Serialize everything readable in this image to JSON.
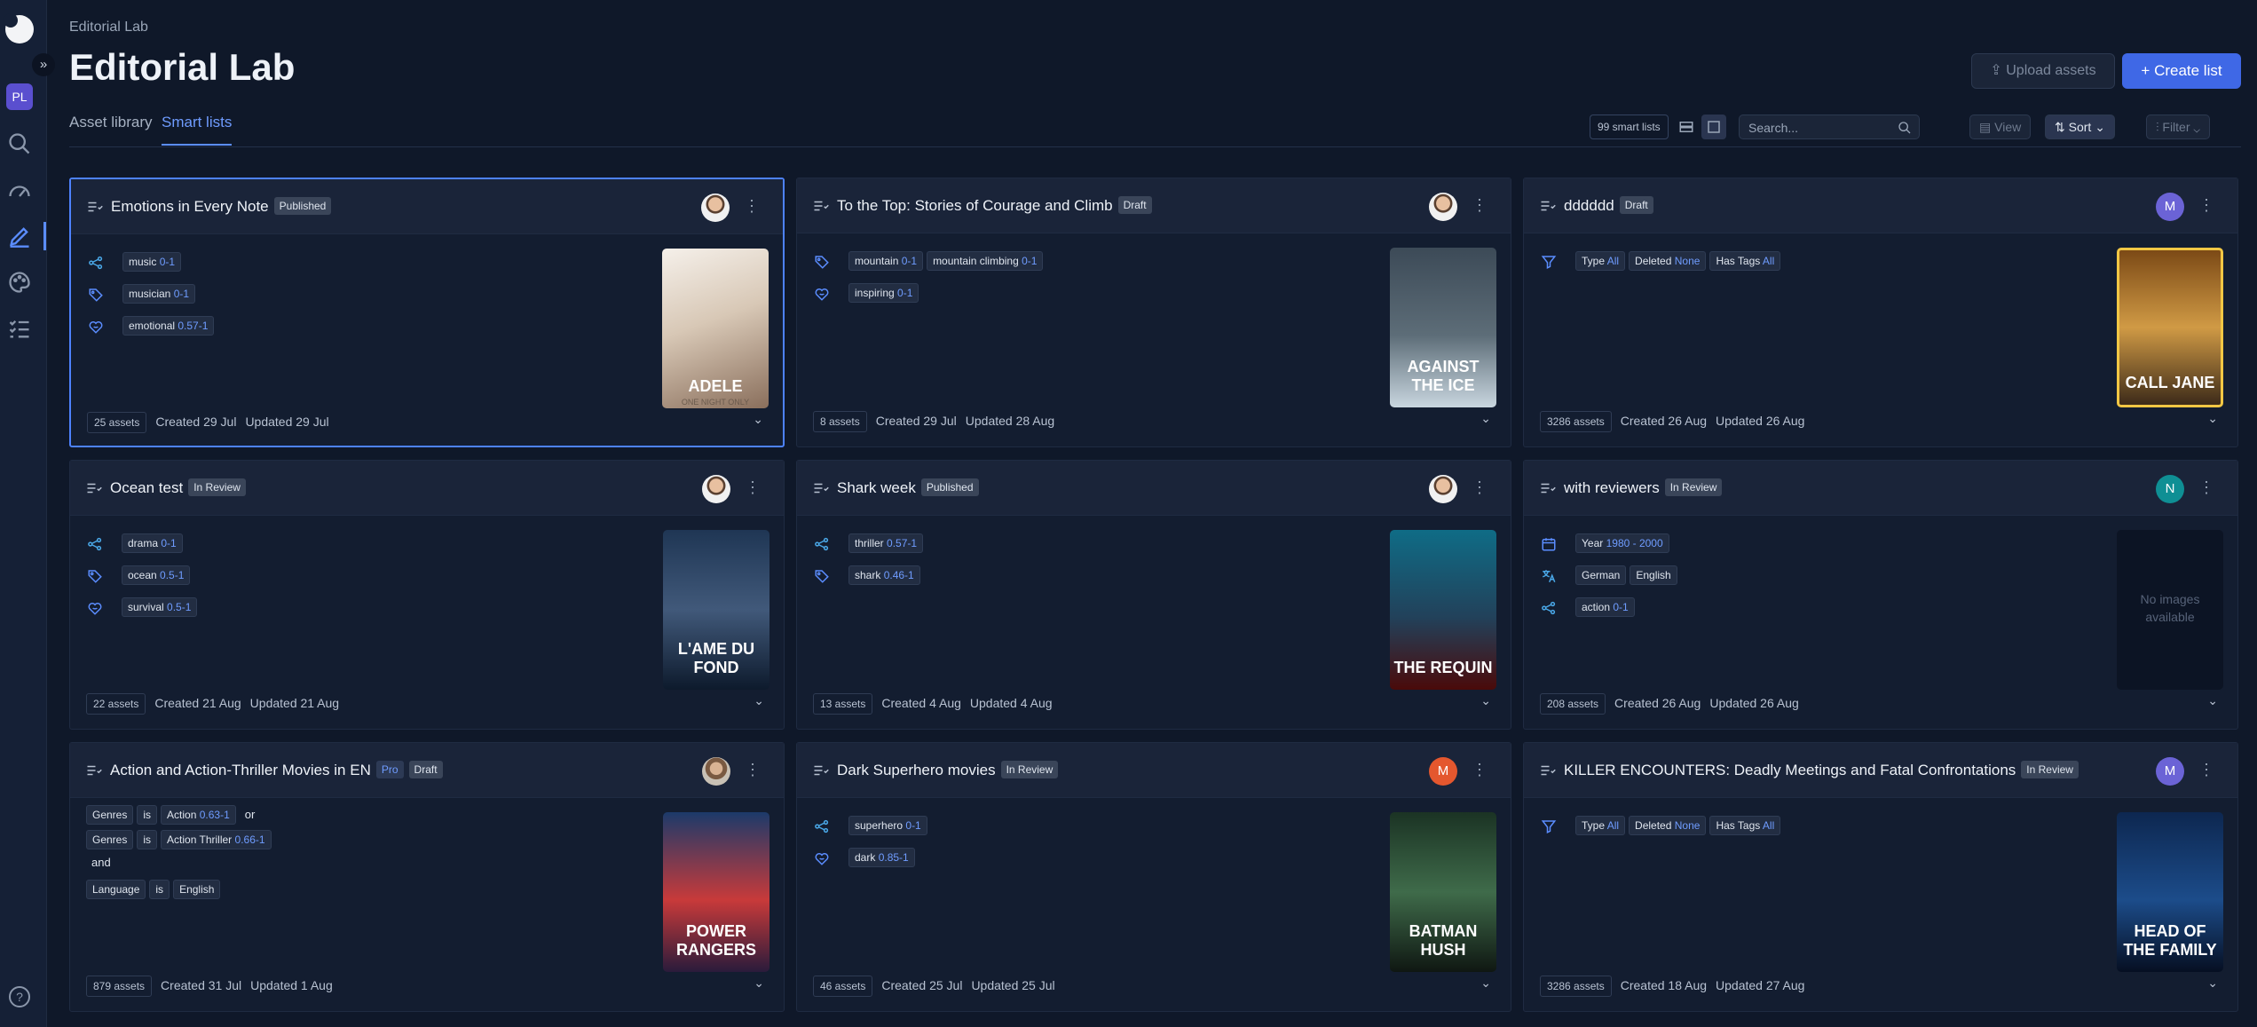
{
  "app": {
    "breadcrumb": "Editorial Lab",
    "title": "Editorial Lab",
    "user_initials": "PL"
  },
  "header": {
    "upload_label": "Upload assets",
    "create_label": "Create list"
  },
  "tabs": [
    {
      "label": "Asset library"
    },
    {
      "label": "Smart lists",
      "active": true
    }
  ],
  "toolbar": {
    "count_label": "99 smart lists",
    "search_placeholder": "Search...",
    "view_label": "View",
    "sort_label": "Sort",
    "filter_label": "Filter"
  },
  "colors": {
    "accent": "#3f68e6",
    "background": "#0f1829",
    "card": "#131d30"
  },
  "cards": [
    {
      "title": "Emotions in Every Note",
      "status": "Published",
      "avatar": {
        "type": "photo"
      },
      "selected": true,
      "rows": [
        {
          "icon": "graph-icon",
          "chips": [
            {
              "label": "music",
              "value": "0-1"
            }
          ]
        },
        {
          "icon": "tag-icon",
          "chips": [
            {
              "label": "musician",
              "value": "0-1"
            }
          ]
        },
        {
          "icon": "emotion-icon",
          "chips": [
            {
              "label": "emotional",
              "value": "0.57-1"
            }
          ]
        }
      ],
      "poster": {
        "text": "ADELE",
        "sub": "ONE NIGHT ONLY"
      },
      "assets": "25 assets",
      "created": "Created 29 Jul",
      "updated": "Updated 29 Jul"
    },
    {
      "title": "To the Top: Stories of Courage and Climb",
      "status": "Draft",
      "avatar": {
        "type": "photo"
      },
      "rows": [
        {
          "icon": "tag-icon",
          "chips": [
            {
              "label": "mountain",
              "value": "0-1"
            },
            {
              "label": "mountain climbing",
              "value": "0-1"
            }
          ]
        },
        {
          "icon": "emotion-icon",
          "chips": [
            {
              "label": "inspiring",
              "value": "0-1"
            }
          ]
        }
      ],
      "poster": {
        "text": "AGAINST THE ICE"
      },
      "assets": "8 assets",
      "created": "Created 29 Jul",
      "updated": "Updated 28 Aug"
    },
    {
      "title": "dddddd",
      "status": "Draft",
      "avatar": {
        "type": "letter",
        "letter": "M",
        "color": "#6b63d6"
      },
      "rows": [
        {
          "icon": "filter-icon",
          "chips": [
            {
              "label": "Type",
              "value": "All"
            },
            {
              "label": "Deleted",
              "value": "None"
            },
            {
              "label": "Has Tags",
              "value": "All"
            }
          ]
        }
      ],
      "poster": {
        "text": "CALL JANE"
      },
      "assets": "3286 assets",
      "created": "Created 26 Aug",
      "updated": "Updated 26 Aug"
    },
    {
      "title": "Ocean test",
      "status": "In Review",
      "avatar": {
        "type": "photo"
      },
      "rows": [
        {
          "icon": "graph-icon",
          "chips": [
            {
              "label": "drama",
              "value": "0-1"
            }
          ]
        },
        {
          "icon": "tag-icon",
          "chips": [
            {
              "label": "ocean",
              "value": "0.5-1"
            }
          ]
        },
        {
          "icon": "emotion-icon",
          "chips": [
            {
              "label": "survival",
              "value": "0.5-1"
            }
          ]
        }
      ],
      "poster": {
        "text": "L'AME DU FOND"
      },
      "assets": "22 assets",
      "created": "Created 21 Aug",
      "updated": "Updated 21 Aug"
    },
    {
      "title": "Shark week",
      "status": "Published",
      "avatar": {
        "type": "photo"
      },
      "rows": [
        {
          "icon": "graph-icon",
          "chips": [
            {
              "label": "thriller",
              "value": "0.57-1"
            }
          ]
        },
        {
          "icon": "tag-icon",
          "chips": [
            {
              "label": "shark",
              "value": "0.46-1"
            }
          ]
        }
      ],
      "poster": {
        "text": "THE REQUIN"
      },
      "assets": "13 assets",
      "created": "Created 4 Aug",
      "updated": "Updated 4 Aug"
    },
    {
      "title": "with reviewers",
      "status": "In Review",
      "avatar": {
        "type": "letter",
        "letter": "N",
        "color": "#0f8f94"
      },
      "rows": [
        {
          "icon": "calendar-icon",
          "chips": [
            {
              "label": "Year",
              "value": "1980 - 2000"
            }
          ]
        },
        {
          "icon": "language-icon",
          "chips": [
            {
              "label": "German",
              "value": ""
            },
            {
              "label": "English",
              "value": ""
            }
          ]
        },
        {
          "icon": "graph-icon",
          "chips": [
            {
              "label": "action",
              "value": "0-1"
            }
          ]
        }
      ],
      "no_image": "No images available",
      "assets": "208 assets",
      "created": "Created 26 Aug",
      "updated": "Updated 26 Aug"
    },
    {
      "title": "Action and Action-Thriller Movies in EN",
      "status": "Draft",
      "pro": "Pro",
      "avatar": {
        "type": "photo2"
      },
      "rules": [
        [
          {
            "chip": "Genres"
          },
          {
            "chip": "is"
          },
          {
            "chip": "Action",
            "value": "0.63-1"
          },
          {
            "text": "or"
          }
        ],
        [
          {
            "chip": "Genres"
          },
          {
            "chip": "is"
          },
          {
            "chip": "Action Thriller",
            "value": "0.66-1"
          }
        ],
        [
          {
            "text": "and"
          }
        ],
        [
          {
            "chip": "Language"
          },
          {
            "chip": "is"
          },
          {
            "chip": "English"
          }
        ]
      ],
      "poster": {
        "text": "POWER RANGERS"
      },
      "assets": "879 assets",
      "created": "Created 31 Jul",
      "updated": "Updated 1 Aug"
    },
    {
      "title": "Dark Superhero movies",
      "status": "In Review",
      "avatar": {
        "type": "letter",
        "letter": "M",
        "color": "#e4572e"
      },
      "rows": [
        {
          "icon": "graph-icon",
          "chips": [
            {
              "label": "superhero",
              "value": "0-1"
            }
          ]
        },
        {
          "icon": "emotion-icon",
          "chips": [
            {
              "label": "dark",
              "value": "0.85-1"
            }
          ]
        }
      ],
      "poster": {
        "text": "BATMAN HUSH"
      },
      "assets": "46 assets",
      "created": "Created 25 Jul",
      "updated": "Updated 25 Jul"
    },
    {
      "title": "KILLER ENCOUNTERS: Deadly Meetings and Fatal Confrontations",
      "status": "In Review",
      "avatar": {
        "type": "letter",
        "letter": "M",
        "color": "#6b63d6"
      },
      "rows": [
        {
          "icon": "filter-icon",
          "chips": [
            {
              "label": "Type",
              "value": "All"
            },
            {
              "label": "Deleted",
              "value": "None"
            },
            {
              "label": "Has Tags",
              "value": "All"
            }
          ]
        }
      ],
      "poster": {
        "text": "HEAD OF THE FAMILY"
      },
      "assets": "3286 assets",
      "created": "Created 18 Aug",
      "updated": "Updated 27 Aug"
    }
  ]
}
